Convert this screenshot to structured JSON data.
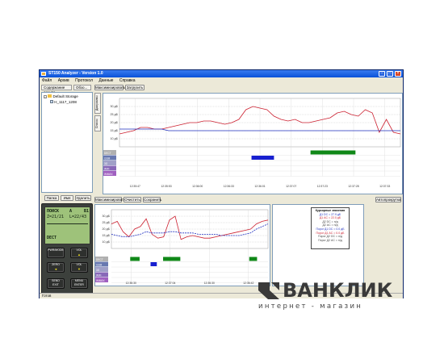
{
  "window": {
    "title": "ST150 Analyzer - Version 1.0"
  },
  "menu": [
    "Файл",
    "Архив",
    "Протокол",
    "Данные",
    "Справка"
  ],
  "left": {
    "tab_archive": "Содержание архива",
    "tab_review": "Обзо...",
    "tree_root": "Default Storage",
    "tree_child": "H_1117_1208",
    "buttons": {
      "folder": "Папка",
      "name": "Имя",
      "delete": "Удалить"
    }
  },
  "device": {
    "lcd": {
      "line1": "ПОИСК",
      "line1_mid": "А",
      "line1_right": "В1",
      "line2_left": "Z=21/21",
      "line2_right": "L=22/43",
      "line3": "DECT"
    },
    "buttons": {
      "pwr": "PWR/MODE",
      "vol_up": "VOL",
      "zero": "ZERO",
      "vol_down": "VOL",
      "send": "SEND",
      "send_sub": "EXIT",
      "menu": "MENU",
      "menu_sub": "ENTER"
    }
  },
  "top_toolbar": {
    "maximize": "Максимизировать",
    "load": "Загрузить"
  },
  "side_tabs": {
    "diagrams": "Диаграммы",
    "list": "Список"
  },
  "top_channels": [
    "DECT",
    "GSM",
    "3G",
    "WiFi",
    "WiMAX"
  ],
  "bottom_toolbar": {
    "maximize": "Максимизировать",
    "clear": "Очистить",
    "save": "Сохранить",
    "autoscroll": "Автопрокрутка"
  },
  "bottom_channels": [
    "DECT",
    "GSM",
    "3G",
    "WiFi",
    "WiMAX"
  ],
  "legend": {
    "title": "Курсорные значения",
    "lines": [
      "Д1 DC = 27.9 дБ",
      "Д1 AC = 22.0 дБ",
      "Д2 DC = н/д",
      "Д2 AC = н/д",
      "Порог Д1 DC = 0.0 дБ",
      "Порог Д1 AC = 0.0 дБ",
      "Порог Д2 DC = н/д",
      "Порог Д2 AC = н/д"
    ]
  },
  "status": "Готов",
  "watermark": {
    "brand": "ВАНКЛИК",
    "sub": "интернет - магазин"
  },
  "colors": {
    "dc": "#cc2030",
    "ac": "#2030c0",
    "dect_bar": "#1820d0",
    "gsm_bar": "#108818",
    "title_bar": "#0a52d8"
  },
  "chart_data": [
    {
      "type": "line",
      "ylabel": "",
      "y_ticks": [
        "30 дБ",
        "25 дБ",
        "20 дБ",
        "15 дБ",
        "10 дБ"
      ],
      "x_ticks": [
        "12:35:47",
        "12:35:53",
        "12:36:00",
        "12:36:33",
        "12:36:01",
        "12:37:07",
        "12:37:23",
        "12:37:28",
        "12:37:33"
      ],
      "series": [
        {
          "values": [
            13,
            14,
            15,
            17,
            17,
            16,
            16,
            17,
            18,
            19,
            20,
            20,
            21,
            21,
            20,
            19,
            20,
            22,
            28,
            30,
            29,
            28,
            24,
            22,
            21,
            22,
            20,
            20,
            21,
            22,
            23,
            26,
            27,
            25,
            24,
            28,
            26,
            14,
            22,
            14,
            13
          ]
        },
        {
          "values": [
            16,
            16,
            16,
            16,
            16,
            16,
            16,
            15,
            15,
            15,
            15,
            15,
            15,
            15,
            15,
            15,
            15,
            15,
            15,
            15,
            15,
            15,
            15,
            15,
            15,
            15,
            15,
            15,
            15,
            15,
            15,
            15,
            15,
            15,
            15,
            15,
            15,
            15,
            15,
            15,
            15
          ]
        }
      ],
      "ylim": [
        5,
        35
      ],
      "events": [
        {
          "channel": "GSM",
          "start": 0.47,
          "end": 0.55
        },
        {
          "channel": "DECT",
          "start": 0.68,
          "end": 0.84
        }
      ]
    },
    {
      "type": "line",
      "ylabel": "",
      "y_ticks": [
        "30 дБ",
        "25 дБ",
        "20 дБ",
        "15 дБ",
        "10 дБ"
      ],
      "x_ticks": [
        "12:36:30",
        "12:37:04",
        "12:36:30",
        "12:36:42"
      ],
      "series": [
        {
          "values": [
            24,
            26,
            18,
            14,
            20,
            22,
            28,
            16,
            13,
            14,
            27,
            30,
            12,
            14,
            15,
            14,
            13,
            13,
            14,
            15,
            16,
            17,
            18,
            19,
            20,
            24,
            26,
            27
          ]
        },
        {
          "values": [
            16,
            15,
            14,
            14,
            15,
            16,
            18,
            17,
            17,
            17,
            18,
            18,
            17,
            17,
            17,
            16,
            16,
            16,
            16,
            15,
            15,
            15,
            15,
            16,
            17,
            20,
            22,
            24
          ]
        }
      ],
      "ylim": [
        5,
        35
      ],
      "events": [
        {
          "channel": "DECT",
          "start": 0.12,
          "end": 0.18
        },
        {
          "channel": "DECT",
          "start": 0.33,
          "end": 0.44
        },
        {
          "channel": "DECT",
          "start": 0.88,
          "end": 0.93
        },
        {
          "channel": "GSM",
          "start": 0.25,
          "end": 0.29
        }
      ]
    }
  ]
}
